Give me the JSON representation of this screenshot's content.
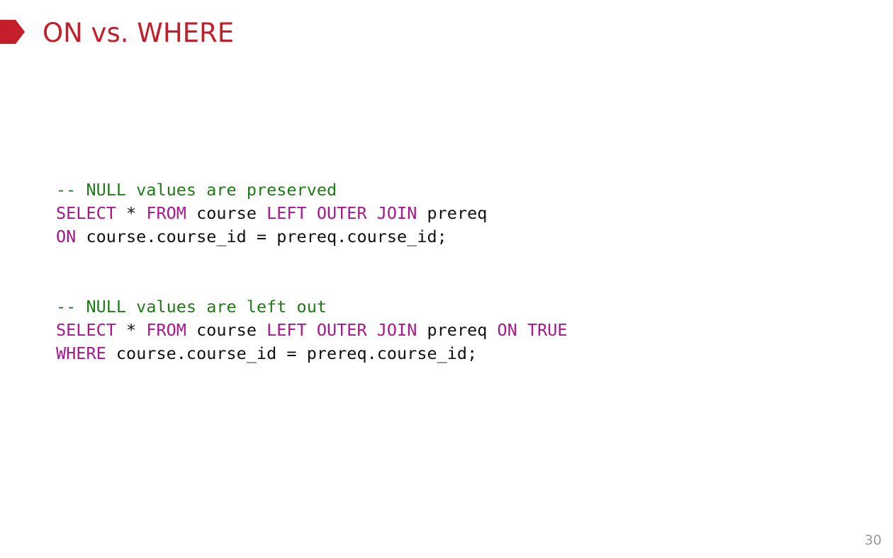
{
  "slide": {
    "title": "ON vs. WHERE",
    "page_number": "30",
    "accent_color": "#c41e2a",
    "comment_color": "#1f7a17",
    "keyword_color": "#a8178e",
    "bullet_icon": "title-marker-pentagon"
  },
  "code_blocks": [
    {
      "lines": [
        [
          {
            "type": "comment",
            "text": "-- NULL values are preserved"
          }
        ],
        [
          {
            "type": "keyword",
            "text": "SELECT"
          },
          {
            "type": "text",
            "text": " * "
          },
          {
            "type": "keyword",
            "text": "FROM"
          },
          {
            "type": "text",
            "text": " course "
          },
          {
            "type": "keyword",
            "text": "LEFT OUTER JOIN"
          },
          {
            "type": "text",
            "text": " prereq"
          }
        ],
        [
          {
            "type": "keyword",
            "text": "ON"
          },
          {
            "type": "text",
            "text": " course.course_id = prereq.course_id;"
          }
        ]
      ]
    },
    {
      "lines": [
        [
          {
            "type": "comment",
            "text": "-- NULL values are left out"
          }
        ],
        [
          {
            "type": "keyword",
            "text": "SELECT"
          },
          {
            "type": "text",
            "text": " * "
          },
          {
            "type": "keyword",
            "text": "FROM"
          },
          {
            "type": "text",
            "text": " course "
          },
          {
            "type": "keyword",
            "text": "LEFT OUTER JOIN"
          },
          {
            "type": "text",
            "text": " prereq "
          },
          {
            "type": "keyword",
            "text": "ON TRUE"
          }
        ],
        [
          {
            "type": "keyword",
            "text": "WHERE"
          },
          {
            "type": "text",
            "text": " course.course_id = prereq.course_id;"
          }
        ]
      ]
    }
  ]
}
